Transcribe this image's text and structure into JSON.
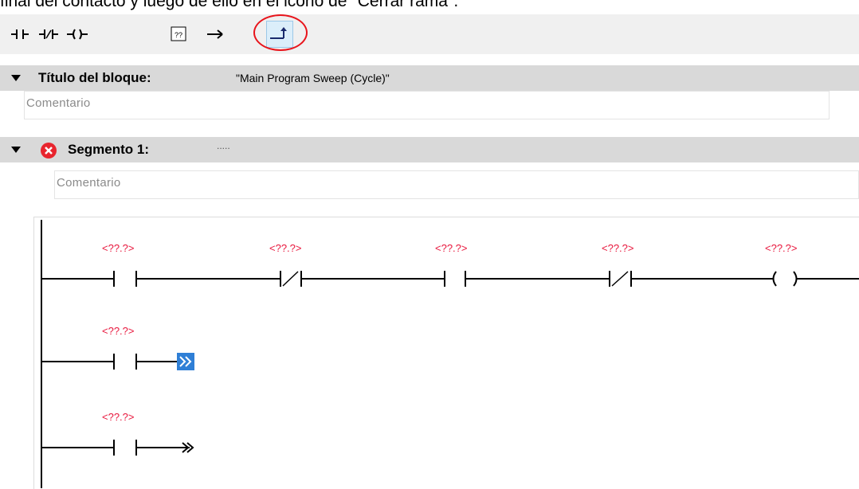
{
  "caption": "final del contacto y luego de ello en el icono de \"Cerrar rama\".",
  "toolbar": {
    "buttons": [
      {
        "name": "contact-no-icon"
      },
      {
        "name": "contact-nc-icon"
      },
      {
        "name": "coil-icon"
      },
      {
        "name": "empty-box-icon",
        "label": "??"
      },
      {
        "name": "open-branch-icon"
      },
      {
        "name": "close-branch-icon",
        "active": true
      }
    ]
  },
  "block": {
    "title_label": "Título del bloque:",
    "title_value": "\"Main Program Sweep (Cycle)\"",
    "comment_placeholder": "Comentario"
  },
  "segment": {
    "label": "Segmento 1:",
    "value": ".....",
    "comment_placeholder": "Comentario",
    "status": "error"
  },
  "ladder": {
    "operands": [
      "<??.?>",
      "<??.?>",
      "<??.?>",
      "<??.?>",
      "<??.?>",
      "<??.?>",
      "<??.?>"
    ],
    "rung1": [
      "contact-no",
      "contact-nc",
      "contact-no",
      "contact-nc",
      "coil"
    ],
    "branch1": [
      "contact-no",
      "open-branch-end"
    ],
    "branch2": [
      "contact-no",
      "branch-arrow-end"
    ]
  },
  "colors": {
    "toolbar_bg": "#f0f0f0",
    "header_bg": "#d9d9d9",
    "operand": "#e8163c",
    "highlight": "#e8141b",
    "error": "#e8252e"
  }
}
